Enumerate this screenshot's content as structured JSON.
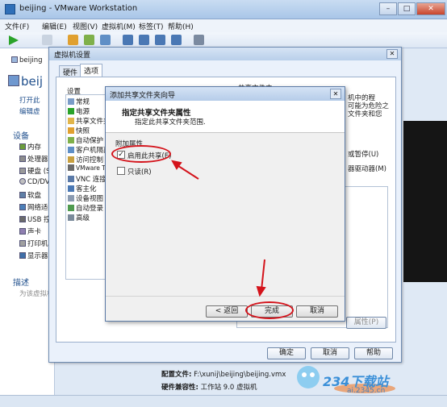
{
  "app": {
    "title": "beijing - VMware Workstation"
  },
  "window_controls": {
    "minimize": "–",
    "maximize": "□",
    "close": "✕"
  },
  "menu": [
    "文件(F)",
    "编辑(E)",
    "视图(V)",
    "虚拟机(M)",
    "标签(T)",
    "帮助(H)"
  ],
  "left_pane": {
    "vm_tab": "beijing",
    "vm_name": "beij",
    "links": [
      "打开此",
      "编辑虚"
    ],
    "devices_header": "设备",
    "devices": [
      "内存",
      "处理器",
      "硬盘 (S",
      "CD/DV",
      "软盘",
      "网络适",
      "USB 控",
      "声卡",
      "打印机",
      "显示器"
    ],
    "desc_header": "描述",
    "desc_placeholder": "为该虚拟机"
  },
  "settings_dialog": {
    "title": "虚拟机设置",
    "close": "✕",
    "tabs": [
      "硬件",
      "选项"
    ],
    "list_header": "设置",
    "items": [
      "常规",
      "电源",
      "共享文件夹",
      "快照",
      "自动保护",
      "客户机隔离",
      "访问控制",
      "VMware Tools",
      "VNC 连接",
      "客主化",
      "设备视图",
      "自动登录",
      "高级"
    ],
    "right_fragments": [
      "共享文件夹",
      "机中的程",
      "可能为危险之",
      "文件夹和您",
      "或暂停(U)",
      "器驱动器(M)"
    ],
    "properties_button": "属性(P)",
    "ok": "确定",
    "cancel": "取消",
    "help": "帮助"
  },
  "wizard": {
    "title": "添加共享文件夹向导",
    "close": "✕",
    "heading": "指定共享文件夹属性",
    "subheading": "指定此共享文件夹范围.",
    "group_label": "附加属性",
    "enable_share": {
      "label": "启用此共享(E)",
      "checked": true,
      "mark": "✓"
    },
    "read_only": {
      "label": "只读(R)",
      "checked": false
    },
    "back": "< 返回",
    "finish": "完成",
    "cancel": "取消"
  },
  "footer": {
    "config_label": "配置文件:",
    "config_value": "F:\\xunij\\beijing\\beijing.vmx",
    "compat_label": "硬件兼容性:",
    "compat_value": "工作站 9.0 虚拟机"
  },
  "watermark": {
    "text": "234下载站",
    "sub": "ai.2345.cn"
  },
  "colors": {
    "annotation_red": "#d4131b",
    "titlebar_blue": "#b9cfea"
  }
}
